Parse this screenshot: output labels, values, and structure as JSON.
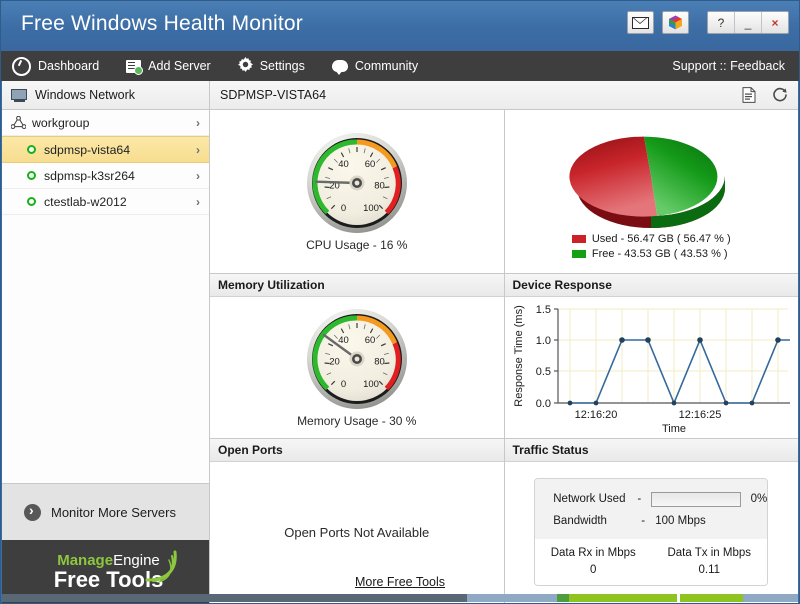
{
  "window": {
    "title": "Free Windows Health Monitor",
    "buttons": {
      "mail_icon": "envelope-icon",
      "apps_icon": "color-cube-icon",
      "help_label": "?",
      "minimize_label": "_",
      "close_label": "×"
    }
  },
  "menubar": {
    "items": [
      {
        "label": "Dashboard",
        "icon": "dashboard-icon"
      },
      {
        "label": "Add Server",
        "icon": "add-server-icon"
      },
      {
        "label": "Settings",
        "icon": "gear-icon"
      },
      {
        "label": "Community",
        "icon": "community-icon"
      }
    ],
    "support_label": "Support",
    "separator": "::",
    "feedback_label": "Feedback"
  },
  "sidebar": {
    "header": {
      "label": "Windows Network",
      "icon": "monitor-icon"
    },
    "tree": [
      {
        "label": "workgroup",
        "type": "group",
        "icon": "network-icon",
        "chevron": "›",
        "selected": false
      },
      {
        "label": "sdpmsp-vista64",
        "type": "server",
        "status": "up",
        "chevron": "›",
        "selected": true
      },
      {
        "label": "sdpmsp-k3sr264",
        "type": "server",
        "status": "up",
        "chevron": "›",
        "selected": false
      },
      {
        "label": "ctestlab-w2012",
        "type": "server",
        "status": "up",
        "chevron": "›",
        "selected": false
      }
    ],
    "monitor_more": {
      "label": "Monitor More Servers",
      "icon": "arrow-circle-icon"
    },
    "logo": {
      "line1_bold": "Manage",
      "line1_rest": "Engine",
      "line2": "Free Tools"
    }
  },
  "content": {
    "header_title": "SDPMSP-VISTA64",
    "report_icon": "report-icon",
    "refresh_icon": "refresh-icon"
  },
  "panels": {
    "cpu": {
      "title": "",
      "caption": "CPU Usage - 16 %",
      "value": 16
    },
    "disk": {
      "title": ""
    },
    "memory": {
      "title": "Memory Utilization",
      "caption": "Memory Usage - 30 %",
      "value": 30
    },
    "device_response": {
      "title": "Device Response"
    },
    "open_ports": {
      "title": "Open Ports",
      "message": "Open Ports Not Available"
    },
    "traffic": {
      "title": "Traffic Status",
      "network_used_label": "Network Used",
      "network_used_dash": "-",
      "network_used_pct": "0%",
      "network_used_value": 0,
      "bandwidth_label": "Bandwidth",
      "bandwidth_dash": "-",
      "bandwidth_value": "100 Mbps",
      "rx_label": "Data Rx in Mbps",
      "rx_value": "0",
      "tx_label": "Data Tx in Mbps",
      "tx_value": "0.11"
    }
  },
  "footer": {
    "link_label": "More Free Tools"
  },
  "colors": {
    "title_bar": "#3c6da4",
    "menu_bar": "#3e3e3e",
    "selection": "#f7dd8f",
    "status_up": "#17b217",
    "pie_used": "#cc2127",
    "pie_free": "#13a113",
    "gauge_green": "#2db82d",
    "gauge_orange": "#f59a20",
    "gauge_red": "#e02020",
    "chart_line": "#35699c",
    "brand_green": "#8dc63f"
  },
  "chart_data": [
    {
      "type": "pie",
      "title": "",
      "labels": [
        "Used",
        "Free"
      ],
      "values": [
        56.47,
        43.53
      ],
      "units": "GB",
      "legend": [
        "Used - 56.47 GB ( 56.47 % )",
        "Free - 43.53 GB ( 43.53 % )"
      ],
      "colors": [
        "#cc2127",
        "#13a113"
      ],
      "legend_position": "bottom"
    },
    {
      "type": "gauge",
      "title": "CPU Usage - 16 %",
      "value": 16,
      "min": 0,
      "max": 100,
      "ticks": [
        0,
        20,
        40,
        60,
        80,
        100
      ],
      "bands": [
        {
          "from": 0,
          "to": 60,
          "color": "#2db82d"
        },
        {
          "from": 60,
          "to": 80,
          "color": "#f59a20"
        },
        {
          "from": 80,
          "to": 100,
          "color": "#e02020"
        }
      ]
    },
    {
      "type": "gauge",
      "title": "Memory Usage - 30 %",
      "value": 30,
      "min": 0,
      "max": 100,
      "ticks": [
        0,
        20,
        40,
        60,
        80,
        100
      ],
      "bands": [
        {
          "from": 0,
          "to": 60,
          "color": "#2db82d"
        },
        {
          "from": 60,
          "to": 80,
          "color": "#f59a20"
        },
        {
          "from": 80,
          "to": 100,
          "color": "#e02020"
        }
      ]
    },
    {
      "type": "line",
      "title": "Device Response",
      "xlabel": "Time",
      "ylabel": "Response Time (ms)",
      "ylim": [
        0,
        1.5
      ],
      "yticks": [
        0.0,
        0.5,
        1.0,
        1.5
      ],
      "ytick_labels": [
        "0.0",
        "0.5",
        "1.0",
        "1.5"
      ],
      "xtick_labels": [
        "12:16:20",
        "12:16:25"
      ],
      "grid": true,
      "values": [
        0.0,
        0.0,
        1.0,
        1.0,
        0.0,
        1.0,
        0.0,
        0.0,
        1.0,
        1.0
      ],
      "line_color": "#35699c"
    },
    {
      "type": "bar",
      "title": "Network Used",
      "categories": [
        "Network Used"
      ],
      "values": [
        0
      ],
      "ylim": [
        0,
        100
      ],
      "ylabel": "%"
    }
  ]
}
